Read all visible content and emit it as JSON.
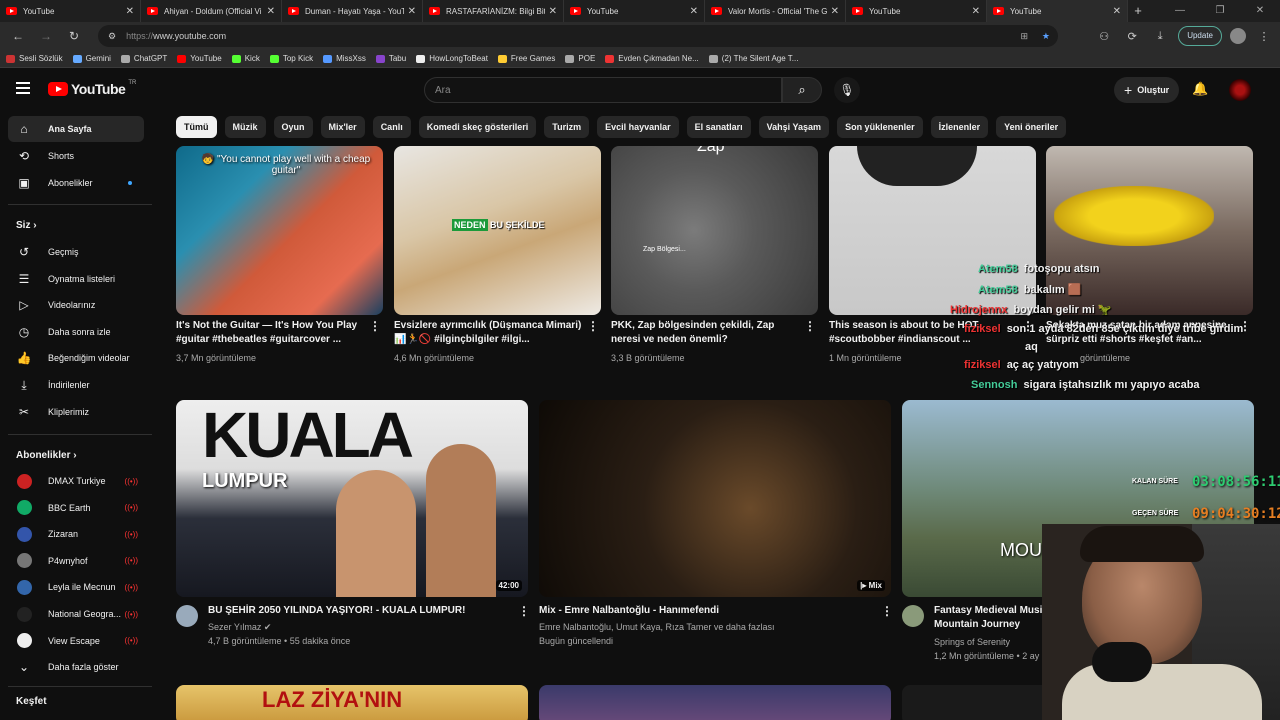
{
  "browser": {
    "tabs": [
      {
        "title": "YouTube"
      },
      {
        "title": "Ahiyan - Doldum (Official Vi"
      },
      {
        "title": "Duman - Hayatı Yaşa - YouTu"
      },
      {
        "title": "RASTAFARİANİZM: Bilgi Bitki"
      },
      {
        "title": "YouTube"
      },
      {
        "title": "Valor Mortis - Official 'The G"
      },
      {
        "title": "YouTube"
      },
      {
        "title": "YouTube"
      }
    ],
    "url_scheme": "https://",
    "url_host": "www.youtube.com",
    "update_label": "Update",
    "bookmarks": [
      {
        "label": "Sesli Sözlük",
        "color": "#c33"
      },
      {
        "label": "Gemini",
        "color": "#6af"
      },
      {
        "label": "ChatGPT",
        "color": "#aaa"
      },
      {
        "label": "YouTube",
        "color": "#f00"
      },
      {
        "label": "Kick",
        "color": "#5f3"
      },
      {
        "label": "Top Kick",
        "color": "#5f3"
      },
      {
        "label": "MissXss",
        "color": "#59f"
      },
      {
        "label": "Tabu",
        "color": "#84c"
      },
      {
        "label": "HowLongToBeat",
        "color": "#eee"
      },
      {
        "label": "Free Games",
        "color": "#fc3"
      },
      {
        "label": "POE",
        "color": "#aaa"
      },
      {
        "label": "Evden Çıkmadan Ne...",
        "color": "#e33"
      },
      {
        "label": "(2) The Silent Age T...",
        "color": "#aaa"
      }
    ]
  },
  "youtube": {
    "logo_text": "YouTube",
    "logo_region": "TR",
    "search_placeholder": "Ara",
    "create_label": "Oluştur",
    "chips": [
      "Tümü",
      "Müzik",
      "Oyun",
      "Mix'ler",
      "Canlı",
      "Komedi skeç gösterileri",
      "Turizm",
      "Evcil hayvanlar",
      "El sanatları",
      "Vahşi Yaşam",
      "Son yüklenenler",
      "İzlenenler",
      "Yeni öneriler"
    ],
    "sidebar": {
      "main": [
        "Ana Sayfa",
        "Shorts",
        "Abonelikler"
      ],
      "you_header": "Siz",
      "you_items": [
        "Geçmiş",
        "Oynatma listeleri",
        "Videolarınız",
        "Daha sonra izle",
        "Beğendiğim videolar",
        "İndirilenler",
        "Kliplerimiz"
      ],
      "subs_header": "Abonelikler",
      "subs": [
        {
          "name": "DMAX Turkiye",
          "color": "#c22"
        },
        {
          "name": "BBC Earth",
          "color": "#1a6"
        },
        {
          "name": "Zizaran",
          "color": "#35a"
        },
        {
          "name": "P4wnyhof",
          "color": "#777"
        },
        {
          "name": "Leyla ile Mecnun",
          "color": "#36a"
        },
        {
          "name": "National Geogra...",
          "color": "#222"
        },
        {
          "name": "View Escape",
          "color": "#eee"
        }
      ],
      "show_more": "Daha fazla göster",
      "explore_header": "Keşfet"
    },
    "row1": [
      {
        "title": "It's Not the Guitar — It's How You Play #guitar #thebeatles  #guitarcover ...",
        "views": "3,7 Mn görüntüleme",
        "overlay": "🧒 \"You cannot play well with a cheap guitar\""
      },
      {
        "title": "Evsizlere ayrımcılık (Düşmanca Mimari) 📊🏃🚫 #ilginçbilgiler #ilgi...",
        "views": "4,6 Mn görüntüleme",
        "overlay_a": "NEDEN",
        "overlay_b": " BU ŞEKİLDE"
      },
      {
        "title": "PKK, Zap bölgesinden çekildi, Zap neresi ve neden önemli?",
        "views": "3,3 B görüntüleme",
        "overlay": "Zap",
        "overlay2": "Zap Bölgesi..."
      },
      {
        "title": "This season is about to be HOT. #scoutbobber #indianscout ...",
        "views": "1 Mn görüntüleme"
      },
      {
        "title": "Sokakta muz satan bir adam annesine sürpriz etti #shorts #keşfet #an...",
        "views": "görüntüleme"
      }
    ],
    "row2": [
      {
        "title": "BU ŞEHİR 2050 YILINDA YAŞIYOR! - KUALA LUMPUR!",
        "channel": "Sezer Yılmaz ✔",
        "meta": "4,7 B görüntüleme • 55 dakika önce",
        "duration": "42:00",
        "big": "KUALA",
        "small": "LUMPUR"
      },
      {
        "title": "Mix - Emre Nalbantoğlu - Hanımefendi",
        "channel": "Emre Nalbantoğlu, Umut Kaya, Rıza Tamer ve daha fazlası",
        "meta": "Bugün güncellendi",
        "badge": "Mix"
      },
      {
        "title": "Fantasy Medieval Music Mountain Journey",
        "channel": "Springs of Serenity",
        "meta": "1,2 Mn görüntüleme • 2 ay",
        "thumb_text": "MOU"
      }
    ],
    "row3": [
      {
        "thumb_text": "LAZ ZİYA'NIN"
      }
    ]
  },
  "stream_overlay": {
    "chat": [
      {
        "user": "Atem58",
        "msg": "fotoşopu atsın",
        "ucolor": "#4c9"
      },
      {
        "user": "Atem58",
        "msg": "bakalım 🟫",
        "ucolor": "#4c9"
      },
      {
        "user": "Hidrojennx",
        "msg": "boydan gelir mi 🦖",
        "ucolor": "#e33"
      },
      {
        "user": "fiziksel",
        "msg": "son 1 ayda 82den 85e çıktım diye tribe girdim",
        "ucolor": "#e33"
      },
      {
        "user": "",
        "msg": "aq",
        "ucolor": "#e33"
      },
      {
        "user": "fiziksel",
        "msg": "aç aç yatıyom",
        "ucolor": "#e33"
      },
      {
        "user": "Sennosh",
        "msg": "sigara iştahsızlık mı yapıyo acaba",
        "ucolor": "#4c9"
      }
    ],
    "remaining_label": "KALAN SÜRE",
    "remaining_value": "03:08:56:11",
    "remaining_color": "#2ecc71",
    "elapsed_label": "GEÇEN SÜRE",
    "elapsed_value": "09:04:30:12",
    "elapsed_color": "#e67e22"
  }
}
